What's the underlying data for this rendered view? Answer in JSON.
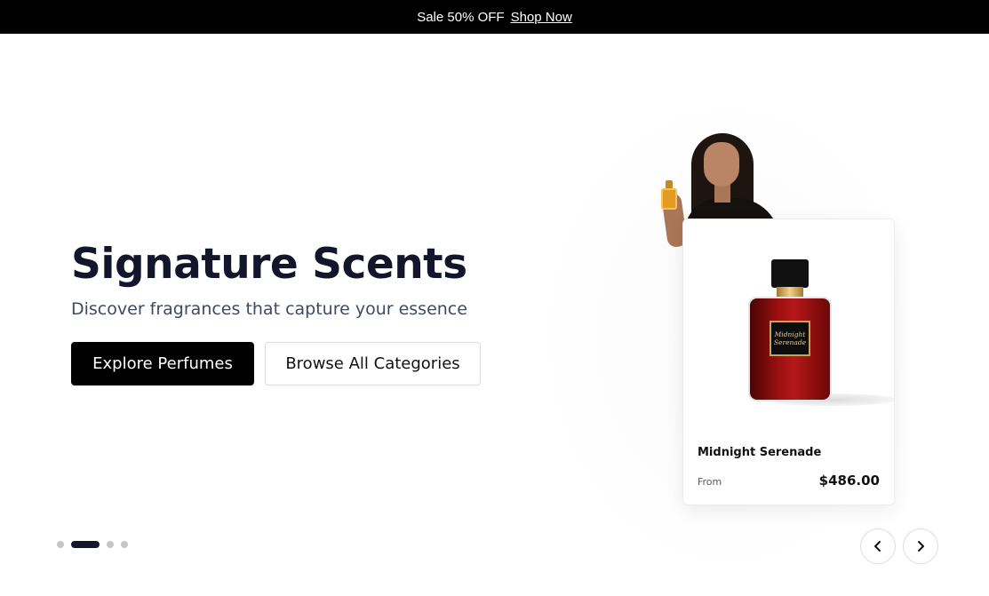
{
  "promo": {
    "text": "Sale 50% OFF",
    "link": "Shop Now"
  },
  "hero": {
    "title": "Signature Scents",
    "subtitle": "Discover fragrances that capture your essence",
    "primary_button": "Explore Perfumes",
    "secondary_button": "Browse All Categories"
  },
  "product": {
    "name": "Midnight Serenade",
    "label_line1": "Midnight",
    "label_line2": "Serenade",
    "price_prefix": "From",
    "price": "$486.00"
  },
  "carousel": {
    "slide_count": 4,
    "active_index": 1
  },
  "icons": {
    "prev": "chevron-left-icon",
    "next": "chevron-right-icon"
  },
  "colors": {
    "promo_bg": "#000000",
    "title": "#13152b",
    "primary_button_bg": "#000000",
    "active_dot": "#13152b",
    "bottle": "#9a0f0f"
  }
}
